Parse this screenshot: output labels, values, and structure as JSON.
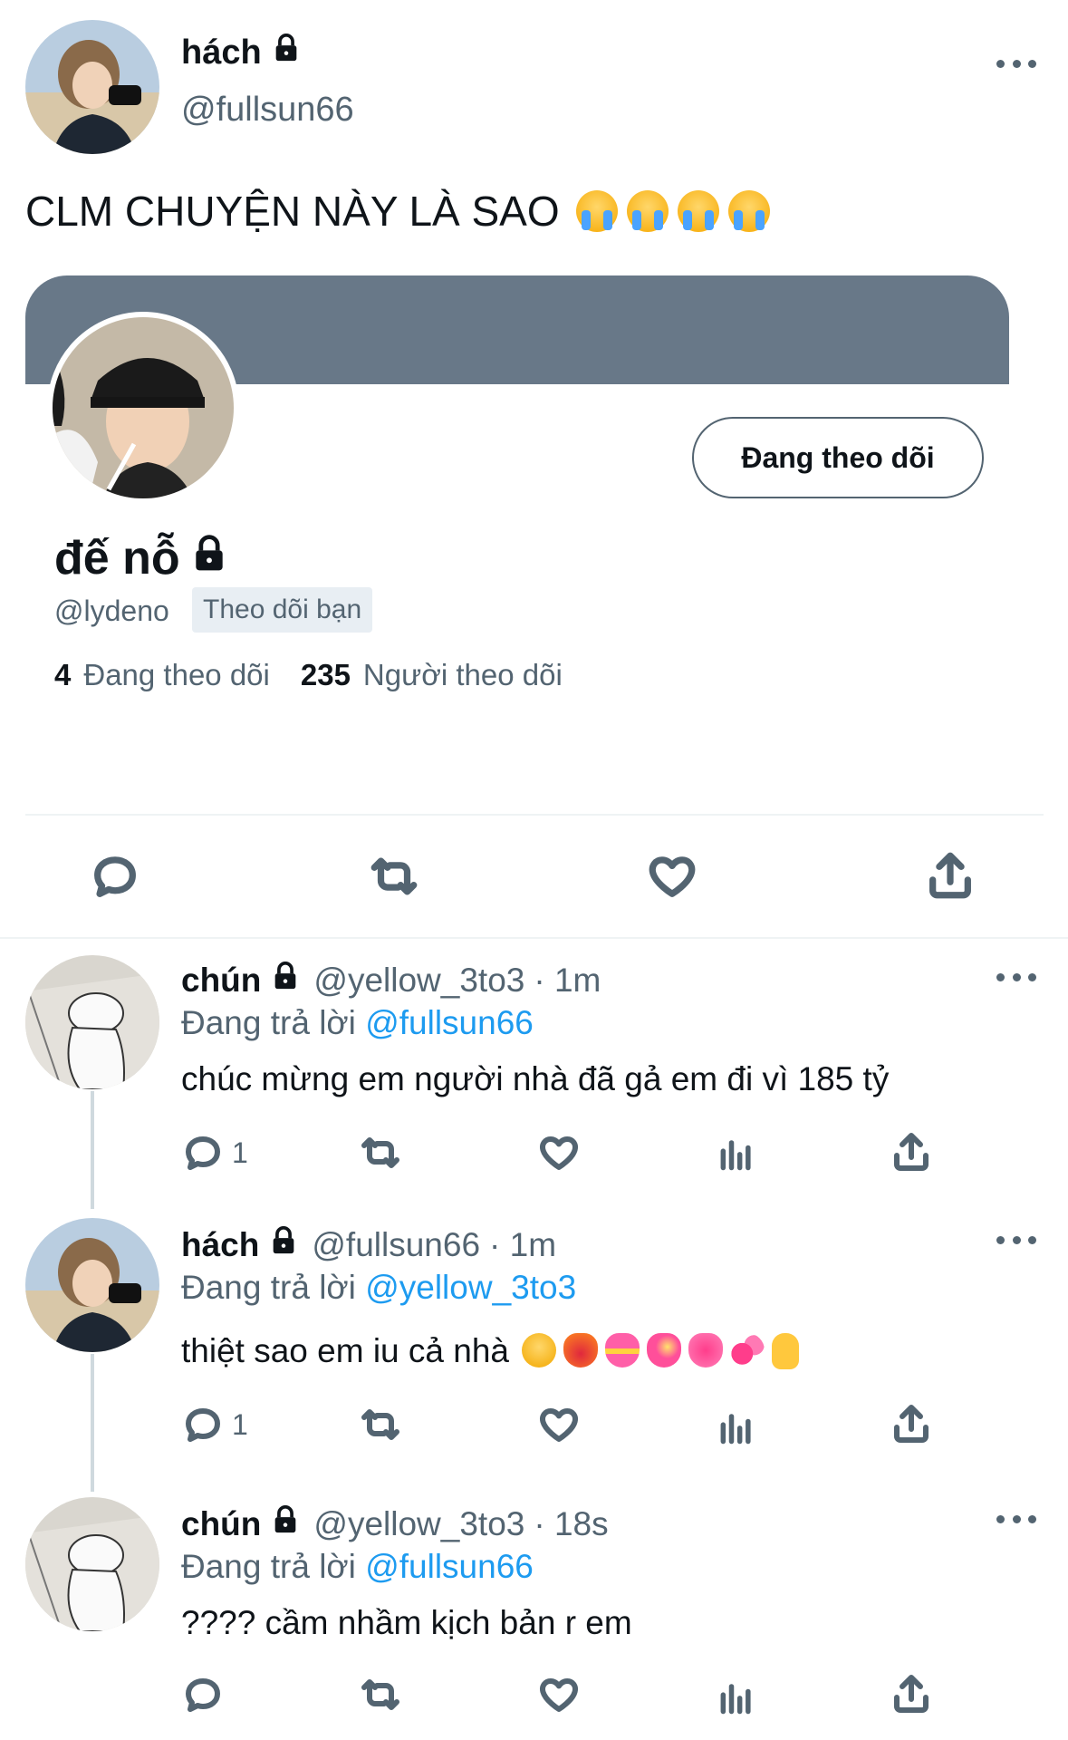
{
  "main_tweet": {
    "display_name": "hách",
    "handle": "@fullsun66",
    "text": "CLM CHUYỆN NÀY LÀ SAO",
    "text_emoji": [
      "loudly-crying-face",
      "loudly-crying-face",
      "loudly-crying-face",
      "loudly-crying-face"
    ]
  },
  "profile_card": {
    "banner_color": "#687888",
    "display_name": "đế nỗ",
    "handle": "@lydeno",
    "follows_you_badge": "Theo dõi bạn",
    "follow_button_label": "Đang theo dõi",
    "following_count": "4",
    "following_label": "Đang theo dõi",
    "followers_count": "235",
    "followers_label": "Người theo dõi"
  },
  "main_actions": [
    "reply",
    "retweet",
    "like",
    "share"
  ],
  "replies": [
    {
      "display_name": "chún",
      "handle": "@yellow_3to3",
      "time": "· 1m",
      "replying_prefix": "Đang trả lời",
      "replying_to": "@fullsun66",
      "text": "chúc mừng em người nhà đã gả em đi vì 185 tỷ",
      "reply_count": "1"
    },
    {
      "display_name": "hách",
      "handle": "@fullsun66",
      "time": "· 1m",
      "replying_prefix": "Đang trả lời",
      "replying_to": "@yellow_3to3",
      "text": "thiệt sao em iu cả nhà",
      "text_emoji": [
        "pleading-face",
        "heart-on-fire",
        "heart-with-ribbon",
        "sparkling-heart",
        "growing-heart",
        "revolving-hearts",
        "pinching-hand"
      ],
      "reply_count": "1"
    },
    {
      "display_name": "chún",
      "handle": "@yellow_3to3",
      "time": "· 18s",
      "replying_prefix": "Đang trả lời",
      "replying_to": "@fullsun66",
      "text": "???? cầm nhầm kịch bản r em",
      "reply_count": ""
    }
  ],
  "colors": {
    "accent": "#1d9bf0",
    "muted": "#536471",
    "border": "#eff3f4"
  }
}
